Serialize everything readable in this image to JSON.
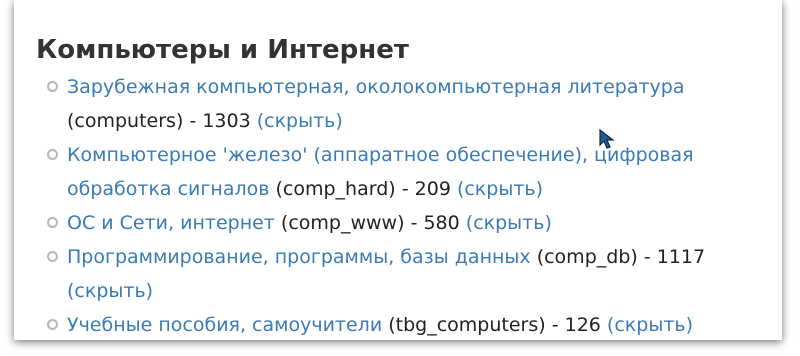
{
  "section": {
    "title": "Компьютеры и Интернет"
  },
  "categories": [
    {
      "name": "Зарубежная компьютерная, околокомпьютерная литература",
      "code": "(computers)",
      "separator": "-",
      "count": "1303",
      "hide_label": "(скрыть)"
    },
    {
      "name": "Компьютерное 'железо' (аппаратное обеспечение), цифровая обработка сигналов",
      "code": "(comp_hard)",
      "separator": "-",
      "count": "209",
      "hide_label": "(скрыть)"
    },
    {
      "name": "ОС и Сети, интернет",
      "code": "(comp_www)",
      "separator": "-",
      "count": "580",
      "hide_label": "(скрыть)"
    },
    {
      "name": "Программирование, программы, базы данных",
      "code": "(comp_db)",
      "separator": "-",
      "count": "1117",
      "hide_label": "(скрыть)"
    },
    {
      "name": "Учебные пособия, самоучители",
      "code": "(tbg_computers)",
      "separator": "-",
      "count": "126",
      "hide_label": "(скрыть)"
    }
  ],
  "colors": {
    "link": "#3a7bb5",
    "text": "#222222",
    "heading": "#333333",
    "bullet": "#b8b8b8"
  },
  "icons": {
    "cursor": "mouse-cursor-icon",
    "bullet": "circle-bullet-icon"
  }
}
